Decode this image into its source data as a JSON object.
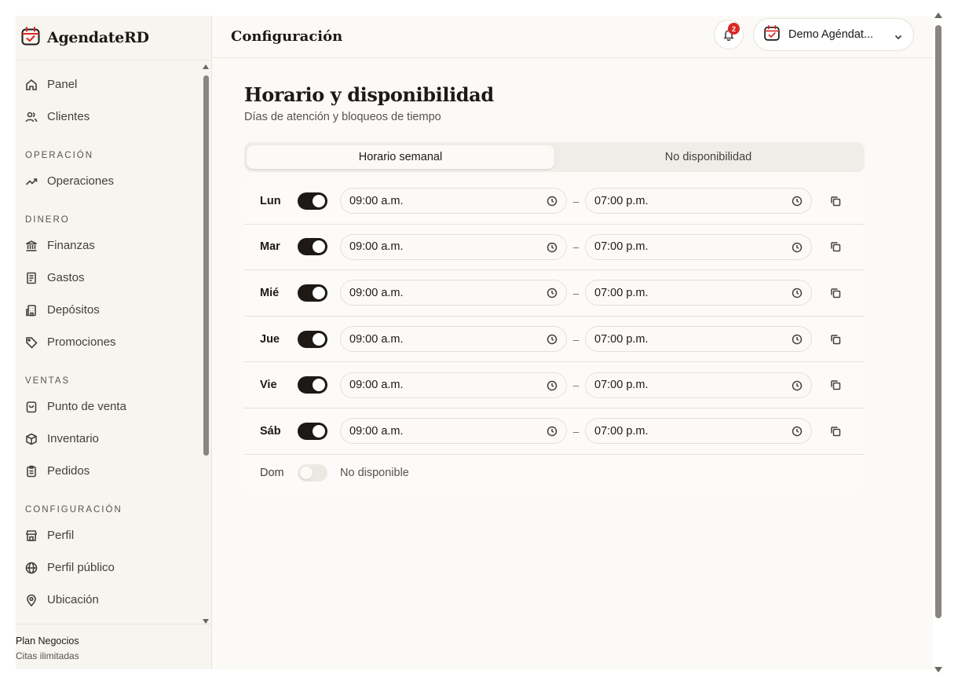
{
  "brand": {
    "name": "AgendateRD",
    "accent": "#dc2626"
  },
  "header": {
    "title": "Configuración",
    "notifications_count": "2",
    "account_name": "Demo Agéndat..."
  },
  "sidebar": {
    "items": [
      {
        "label": "Panel",
        "icon": "home-icon"
      },
      {
        "label": "Clientes",
        "icon": "users-icon"
      }
    ],
    "sections": [
      {
        "title": "OPERACIÓN",
        "items": [
          {
            "label": "Operaciones",
            "icon": "trend-icon"
          }
        ]
      },
      {
        "title": "DINERO",
        "items": [
          {
            "label": "Finanzas",
            "icon": "bank-icon"
          },
          {
            "label": "Gastos",
            "icon": "receipt-icon"
          },
          {
            "label": "Depósitos",
            "icon": "building-icon"
          },
          {
            "label": "Promociones",
            "icon": "tag-icon"
          }
        ]
      },
      {
        "title": "VENTAS",
        "items": [
          {
            "label": "Punto de venta",
            "icon": "bag-icon"
          },
          {
            "label": "Inventario",
            "icon": "box-icon"
          },
          {
            "label": "Pedidos",
            "icon": "clipboard-icon"
          }
        ]
      },
      {
        "title": "CONFIGURACIÓN",
        "items": [
          {
            "label": "Perfil",
            "icon": "store-icon"
          },
          {
            "label": "Perfil público",
            "icon": "globe-icon"
          },
          {
            "label": "Ubicación",
            "icon": "pin-icon"
          }
        ]
      }
    ]
  },
  "plan": {
    "name": "Plan Negocios",
    "detail": "Citas ilimitadas"
  },
  "page": {
    "title": "Horario y disponibilidad",
    "subtitle": "Días de atención y bloqueos de tiempo",
    "tabs": [
      {
        "label": "Horario semanal",
        "active": true
      },
      {
        "label": "No disponibilidad",
        "active": false
      }
    ]
  },
  "schedule": {
    "days": [
      {
        "day": "Lun",
        "enabled": true,
        "start": "09:00 a.m.",
        "end": "07:00 p.m."
      },
      {
        "day": "Mar",
        "enabled": true,
        "start": "09:00 a.m.",
        "end": "07:00 p.m."
      },
      {
        "day": "Mié",
        "enabled": true,
        "start": "09:00 a.m.",
        "end": "07:00 p.m."
      },
      {
        "day": "Jue",
        "enabled": true,
        "start": "09:00 a.m.",
        "end": "07:00 p.m."
      },
      {
        "day": "Vie",
        "enabled": true,
        "start": "09:00 a.m.",
        "end": "07:00 p.m."
      },
      {
        "day": "Sáb",
        "enabled": true,
        "start": "09:00 a.m.",
        "end": "07:00 p.m."
      }
    ],
    "sunday": {
      "day": "Dom",
      "enabled": false,
      "status": "No disponible"
    },
    "separator": "–"
  }
}
